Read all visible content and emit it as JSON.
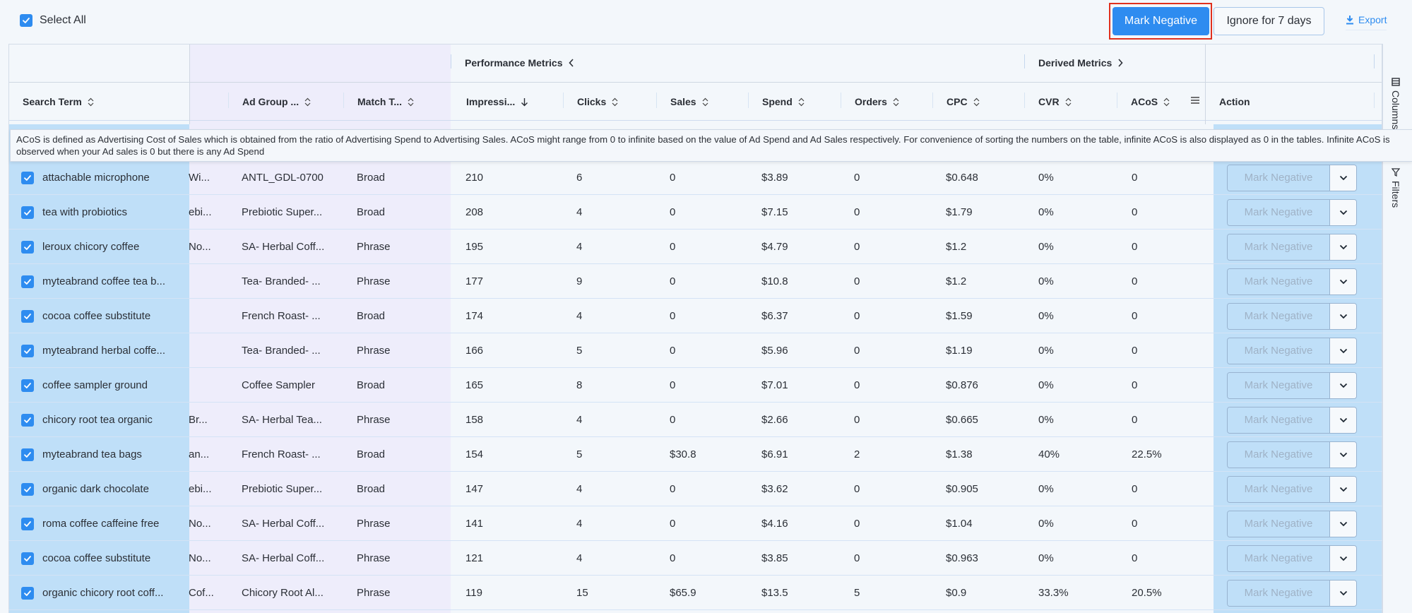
{
  "toolbar": {
    "select_all_label": "Select All",
    "select_all_checked": true,
    "mark_negative_label": "Mark Negative",
    "ignore_label": "Ignore for 7 days",
    "export_label": "Export"
  },
  "colors": {
    "accent": "#2e8cf0",
    "selected_row": "#bfdff8",
    "group_band": "#eeedfb",
    "highlight": "#e0301e"
  },
  "column_groups": {
    "performance": "Performance Metrics",
    "derived": "Derived Metrics"
  },
  "columns": {
    "search_term": "Search Term",
    "ad_group": "Ad Group ...",
    "match_type": "Match T...",
    "impressions": "Impressi...",
    "clicks": "Clicks",
    "sales": "Sales",
    "spend": "Spend",
    "orders": "Orders",
    "cpc": "CPC",
    "cvr": "CVR",
    "acos": "ACoS",
    "action": "Action"
  },
  "sort": {
    "column": "impressions",
    "direction": "desc"
  },
  "tooltip": {
    "text": "ACoS is defined as Advertising Cost of Sales which is obtained from the ratio of Advertising Spend to Advertising Sales. ACoS might range from 0 to infinite based on the value of Ad Spend and Ad Sales respectively. For convenience of sorting the numbers on the table, infinite ACoS is also displayed as 0 in the tables. Infinite ACoS is observed when your Ad sales is 0 but there is any Ad Spend"
  },
  "side_panel": {
    "columns_label": "Columns",
    "filters_label": "Filters"
  },
  "row_action_label": "Mark Negative",
  "rows": [
    {
      "term": "attachable microphone",
      "campaign": "Wi...",
      "ad_group": "ANTL_GDL-0700",
      "match": "Broad",
      "impressions": "210",
      "clicks": "6",
      "sales": "0",
      "spend": "$3.89",
      "orders": "0",
      "cpc": "$0.648",
      "cvr": "0%",
      "acos": "0"
    },
    {
      "term": "tea with probiotics",
      "campaign": "ebi...",
      "ad_group": "Prebiotic Super...",
      "match": "Broad",
      "impressions": "208",
      "clicks": "4",
      "sales": "0",
      "spend": "$7.15",
      "orders": "0",
      "cpc": "$1.79",
      "cvr": "0%",
      "acos": "0"
    },
    {
      "term": "leroux chicory coffee",
      "campaign": "No...",
      "ad_group": "SA- Herbal Coff...",
      "match": "Phrase",
      "impressions": "195",
      "clicks": "4",
      "sales": "0",
      "spend": "$4.79",
      "orders": "0",
      "cpc": "$1.2",
      "cvr": "0%",
      "acos": "0"
    },
    {
      "term": "myteabrand coffee tea b...",
      "campaign": "",
      "ad_group": "Tea- Branded- ...",
      "match": "Phrase",
      "impressions": "177",
      "clicks": "9",
      "sales": "0",
      "spend": "$10.8",
      "orders": "0",
      "cpc": "$1.2",
      "cvr": "0%",
      "acos": "0"
    },
    {
      "term": "cocoa coffee substitute",
      "campaign": "",
      "ad_group": "French Roast- ...",
      "match": "Broad",
      "impressions": "174",
      "clicks": "4",
      "sales": "0",
      "spend": "$6.37",
      "orders": "0",
      "cpc": "$1.59",
      "cvr": "0%",
      "acos": "0"
    },
    {
      "term": "myteabrand herbal coffe...",
      "campaign": "",
      "ad_group": "Tea- Branded- ...",
      "match": "Phrase",
      "impressions": "166",
      "clicks": "5",
      "sales": "0",
      "spend": "$5.96",
      "orders": "0",
      "cpc": "$1.19",
      "cvr": "0%",
      "acos": "0"
    },
    {
      "term": "coffee sampler ground",
      "campaign": "",
      "ad_group": "Coffee Sampler",
      "match": "Broad",
      "impressions": "165",
      "clicks": "8",
      "sales": "0",
      "spend": "$7.01",
      "orders": "0",
      "cpc": "$0.876",
      "cvr": "0%",
      "acos": "0"
    },
    {
      "term": "chicory root tea organic",
      "campaign": "Br...",
      "ad_group": "SA- Herbal Tea...",
      "match": "Phrase",
      "impressions": "158",
      "clicks": "4",
      "sales": "0",
      "spend": "$2.66",
      "orders": "0",
      "cpc": "$0.665",
      "cvr": "0%",
      "acos": "0"
    },
    {
      "term": "myteabrand tea bags",
      "campaign": "an...",
      "ad_group": "French Roast- ...",
      "match": "Broad",
      "impressions": "154",
      "clicks": "5",
      "sales": "$30.8",
      "spend": "$6.91",
      "orders": "2",
      "cpc": "$1.38",
      "cvr": "40%",
      "acos": "22.5%"
    },
    {
      "term": "organic dark chocolate",
      "campaign": "ebi...",
      "ad_group": "Prebiotic Super...",
      "match": "Broad",
      "impressions": "147",
      "clicks": "4",
      "sales": "0",
      "spend": "$3.62",
      "orders": "0",
      "cpc": "$0.905",
      "cvr": "0%",
      "acos": "0"
    },
    {
      "term": "roma coffee caffeine free",
      "campaign": "No...",
      "ad_group": "SA- Herbal Coff...",
      "match": "Phrase",
      "impressions": "141",
      "clicks": "4",
      "sales": "0",
      "spend": "$4.16",
      "orders": "0",
      "cpc": "$1.04",
      "cvr": "0%",
      "acos": "0"
    },
    {
      "term": "cocoa coffee substitute",
      "campaign": "No...",
      "ad_group": "SA- Herbal Coff...",
      "match": "Phrase",
      "impressions": "121",
      "clicks": "4",
      "sales": "0",
      "spend": "$3.85",
      "orders": "0",
      "cpc": "$0.963",
      "cvr": "0%",
      "acos": "0"
    },
    {
      "term": "organic chicory root coff...",
      "campaign": "Cof...",
      "ad_group": "Chicory Root Al...",
      "match": "Phrase",
      "impressions": "119",
      "clicks": "15",
      "sales": "$65.9",
      "spend": "$13.5",
      "orders": "5",
      "cpc": "$0.9",
      "cvr": "33.3%",
      "acos": "20.5%"
    }
  ]
}
